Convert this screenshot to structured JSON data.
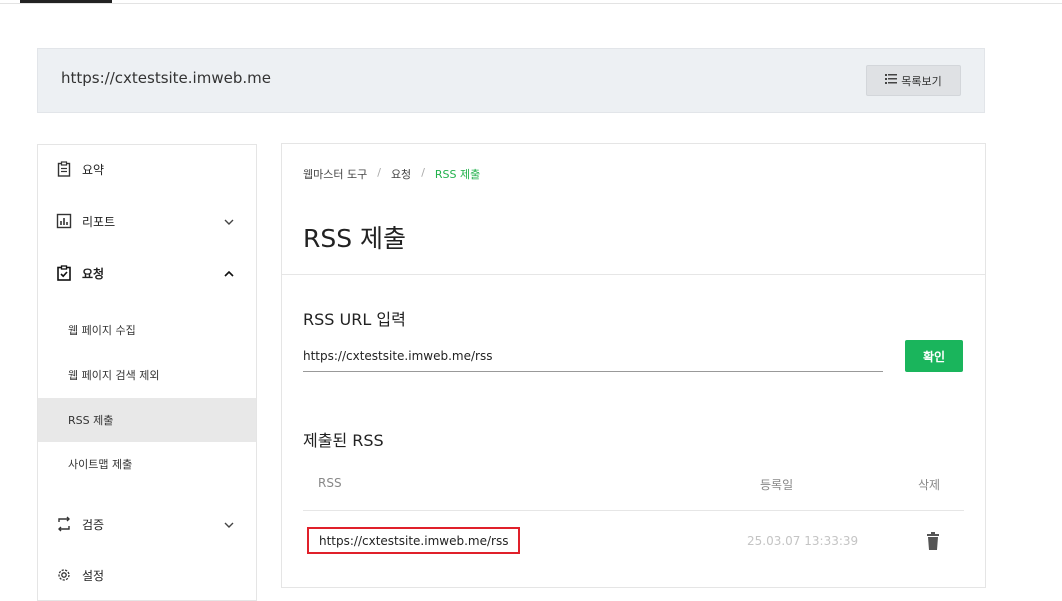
{
  "site": {
    "url": "https://cxtestsite.imweb.me",
    "list_button": "목록보기"
  },
  "sidebar": {
    "items": [
      {
        "label": "요약",
        "icon": "clipboard-icon"
      },
      {
        "label": "리포트",
        "icon": "bar-chart-icon"
      },
      {
        "label": "요청",
        "icon": "checked-clipboard-icon"
      },
      {
        "label": "검증",
        "icon": "swap-arrows-icon"
      },
      {
        "label": "설정",
        "icon": "gear-icon"
      }
    ],
    "sub_items": [
      {
        "label": "웹 페이지 수집"
      },
      {
        "label": "웹 페이지 검색 제외"
      },
      {
        "label": "RSS 제출"
      },
      {
        "label": "사이트맵 제출"
      }
    ],
    "active_sub_item": "RSS 제출"
  },
  "breadcrumb": [
    "웹마스터 도구",
    "요청",
    "RSS 제출"
  ],
  "page": {
    "title": "RSS 제출",
    "input_section_title": "RSS URL 입력",
    "input_value": "https://cxtestsite.imweb.me/rss",
    "confirm_button": "확인",
    "submitted_section_title": "제출된 RSS"
  },
  "table": {
    "headers": [
      "RSS",
      "등록일",
      "삭제"
    ],
    "rows": [
      {
        "rss": "https://cxtestsite.imweb.me/rss",
        "date": "25.03.07 13:33:39"
      }
    ]
  },
  "colors": {
    "accent": "#1ab55c",
    "highlight_border": "#e0202a"
  }
}
